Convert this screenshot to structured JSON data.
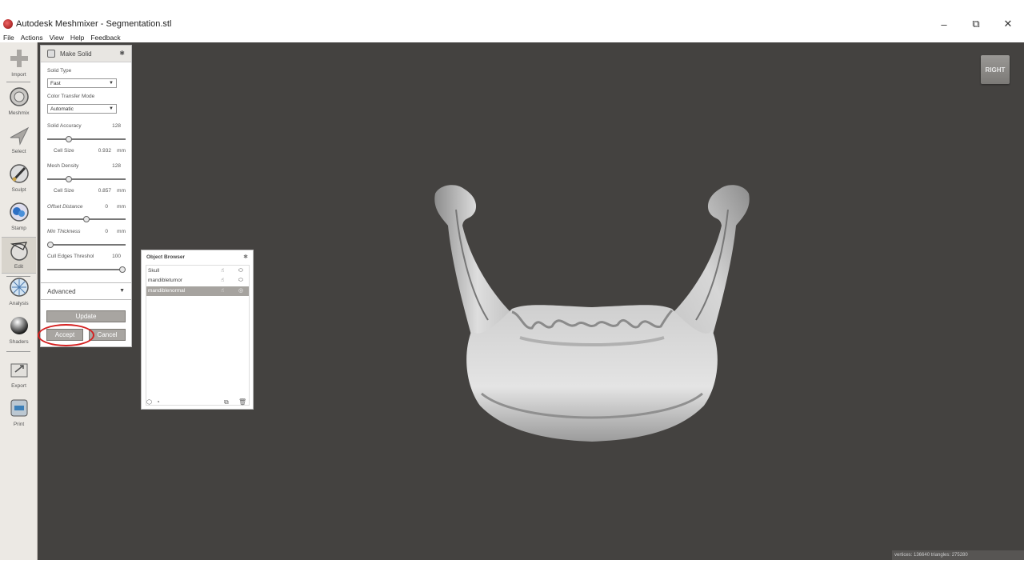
{
  "window": {
    "title": "Autodesk Meshmixer - Segmentation.stl",
    "minimize": "–",
    "restore": "⧉",
    "close": "✕"
  },
  "menu": [
    "File",
    "Actions",
    "View",
    "Help",
    "Feedback"
  ],
  "toolbar": [
    {
      "label": "Import",
      "icon": "plus-icon"
    },
    {
      "label": "Meshmix",
      "icon": "meshmix-icon"
    },
    {
      "label": "Select",
      "icon": "select-arrow-icon"
    },
    {
      "label": "Sculpt",
      "icon": "sculpt-brush-icon"
    },
    {
      "label": "Stamp",
      "icon": "stamp-icon"
    },
    {
      "label": "Edit",
      "icon": "edit-icon"
    },
    {
      "label": "Analysis",
      "icon": "analysis-icon"
    },
    {
      "label": "Shaders",
      "icon": "shaders-icon"
    },
    {
      "label": "Export",
      "icon": "export-icon"
    },
    {
      "label": "Print",
      "icon": "print-icon"
    }
  ],
  "make_solid": {
    "title": "Make Solid",
    "solid_type_label": "Solid Type",
    "solid_type_value": "Fast",
    "color_transfer_label": "Color Transfer Mode",
    "color_transfer_value": "Automatic",
    "solid_accuracy_label": "Solid Accuracy",
    "solid_accuracy_value": "128",
    "solid_accuracy_level": 0.25,
    "cell_size_label": "Cell Size",
    "cell_size_1_value": "0.932",
    "cell_size_unit": "mm",
    "mesh_density_label": "Mesh Density",
    "mesh_density_value": "128",
    "mesh_density_level": 0.25,
    "cell_size_2_value": "0.857",
    "offset_distance_label": "Offset Distance",
    "offset_distance_value": "0",
    "offset_distance_level": 0.5,
    "min_thickness_label": "Min Thickness",
    "min_thickness_value": "0",
    "min_thickness_level": 0.0,
    "cull_edges_label": "Cull Edges Threshol",
    "cull_edges_value": "100",
    "cull_edges_level": 1.0,
    "advanced_label": "Advanced",
    "update_label": "Update",
    "accept_label": "Accept",
    "cancel_label": "Cancel"
  },
  "object_browser": {
    "title": "Object Browser",
    "items": [
      {
        "name": "Skull",
        "selected": false
      },
      {
        "name": "mandibletumor",
        "selected": false
      },
      {
        "name": "mandiblenormal",
        "selected": true
      }
    ]
  },
  "viewcube_label": "RIGHT",
  "status": "vertices: 136640 triangles: 275280",
  "colors": {
    "viewport": "#444240",
    "panel_button": "#a8a5a1",
    "highlight_ring": "#d42020"
  }
}
